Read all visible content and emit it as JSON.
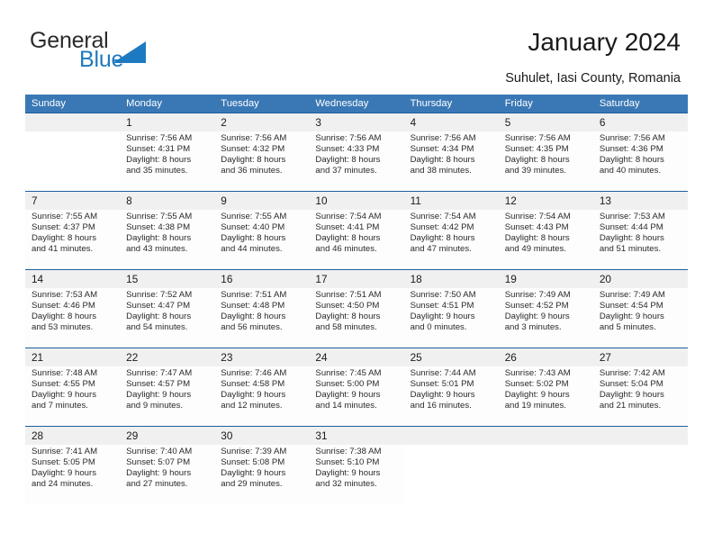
{
  "logo": {
    "word_one": "General",
    "word_two": "Blue",
    "triangle_color": "#1e7ac0"
  },
  "header": {
    "title": "January 2024",
    "subtitle": "Suhulet, Iasi County, Romania"
  },
  "colors": {
    "header_bar": "#3a78b5",
    "week_separator": "#1f5f9e",
    "daynum_band": "#f0f0f0",
    "logo_blue": "#1e7ac0"
  },
  "weekdays": [
    "Sunday",
    "Monday",
    "Tuesday",
    "Wednesday",
    "Thursday",
    "Friday",
    "Saturday"
  ],
  "weeks": [
    {
      "days": [
        {
          "num": "",
          "lines": []
        },
        {
          "num": "1",
          "lines": [
            "Sunrise: 7:56 AM",
            "Sunset: 4:31 PM",
            "Daylight: 8 hours",
            "and 35 minutes."
          ]
        },
        {
          "num": "2",
          "lines": [
            "Sunrise: 7:56 AM",
            "Sunset: 4:32 PM",
            "Daylight: 8 hours",
            "and 36 minutes."
          ]
        },
        {
          "num": "3",
          "lines": [
            "Sunrise: 7:56 AM",
            "Sunset: 4:33 PM",
            "Daylight: 8 hours",
            "and 37 minutes."
          ]
        },
        {
          "num": "4",
          "lines": [
            "Sunrise: 7:56 AM",
            "Sunset: 4:34 PM",
            "Daylight: 8 hours",
            "and 38 minutes."
          ]
        },
        {
          "num": "5",
          "lines": [
            "Sunrise: 7:56 AM",
            "Sunset: 4:35 PM",
            "Daylight: 8 hours",
            "and 39 minutes."
          ]
        },
        {
          "num": "6",
          "lines": [
            "Sunrise: 7:56 AM",
            "Sunset: 4:36 PM",
            "Daylight: 8 hours",
            "and 40 minutes."
          ]
        }
      ]
    },
    {
      "days": [
        {
          "num": "7",
          "lines": [
            "Sunrise: 7:55 AM",
            "Sunset: 4:37 PM",
            "Daylight: 8 hours",
            "and 41 minutes."
          ]
        },
        {
          "num": "8",
          "lines": [
            "Sunrise: 7:55 AM",
            "Sunset: 4:38 PM",
            "Daylight: 8 hours",
            "and 43 minutes."
          ]
        },
        {
          "num": "9",
          "lines": [
            "Sunrise: 7:55 AM",
            "Sunset: 4:40 PM",
            "Daylight: 8 hours",
            "and 44 minutes."
          ]
        },
        {
          "num": "10",
          "lines": [
            "Sunrise: 7:54 AM",
            "Sunset: 4:41 PM",
            "Daylight: 8 hours",
            "and 46 minutes."
          ]
        },
        {
          "num": "11",
          "lines": [
            "Sunrise: 7:54 AM",
            "Sunset: 4:42 PM",
            "Daylight: 8 hours",
            "and 47 minutes."
          ]
        },
        {
          "num": "12",
          "lines": [
            "Sunrise: 7:54 AM",
            "Sunset: 4:43 PM",
            "Daylight: 8 hours",
            "and 49 minutes."
          ]
        },
        {
          "num": "13",
          "lines": [
            "Sunrise: 7:53 AM",
            "Sunset: 4:44 PM",
            "Daylight: 8 hours",
            "and 51 minutes."
          ]
        }
      ]
    },
    {
      "days": [
        {
          "num": "14",
          "lines": [
            "Sunrise: 7:53 AM",
            "Sunset: 4:46 PM",
            "Daylight: 8 hours",
            "and 53 minutes."
          ]
        },
        {
          "num": "15",
          "lines": [
            "Sunrise: 7:52 AM",
            "Sunset: 4:47 PM",
            "Daylight: 8 hours",
            "and 54 minutes."
          ]
        },
        {
          "num": "16",
          "lines": [
            "Sunrise: 7:51 AM",
            "Sunset: 4:48 PM",
            "Daylight: 8 hours",
            "and 56 minutes."
          ]
        },
        {
          "num": "17",
          "lines": [
            "Sunrise: 7:51 AM",
            "Sunset: 4:50 PM",
            "Daylight: 8 hours",
            "and 58 minutes."
          ]
        },
        {
          "num": "18",
          "lines": [
            "Sunrise: 7:50 AM",
            "Sunset: 4:51 PM",
            "Daylight: 9 hours",
            "and 0 minutes."
          ]
        },
        {
          "num": "19",
          "lines": [
            "Sunrise: 7:49 AM",
            "Sunset: 4:52 PM",
            "Daylight: 9 hours",
            "and 3 minutes."
          ]
        },
        {
          "num": "20",
          "lines": [
            "Sunrise: 7:49 AM",
            "Sunset: 4:54 PM",
            "Daylight: 9 hours",
            "and 5 minutes."
          ]
        }
      ]
    },
    {
      "days": [
        {
          "num": "21",
          "lines": [
            "Sunrise: 7:48 AM",
            "Sunset: 4:55 PM",
            "Daylight: 9 hours",
            "and 7 minutes."
          ]
        },
        {
          "num": "22",
          "lines": [
            "Sunrise: 7:47 AM",
            "Sunset: 4:57 PM",
            "Daylight: 9 hours",
            "and 9 minutes."
          ]
        },
        {
          "num": "23",
          "lines": [
            "Sunrise: 7:46 AM",
            "Sunset: 4:58 PM",
            "Daylight: 9 hours",
            "and 12 minutes."
          ]
        },
        {
          "num": "24",
          "lines": [
            "Sunrise: 7:45 AM",
            "Sunset: 5:00 PM",
            "Daylight: 9 hours",
            "and 14 minutes."
          ]
        },
        {
          "num": "25",
          "lines": [
            "Sunrise: 7:44 AM",
            "Sunset: 5:01 PM",
            "Daylight: 9 hours",
            "and 16 minutes."
          ]
        },
        {
          "num": "26",
          "lines": [
            "Sunrise: 7:43 AM",
            "Sunset: 5:02 PM",
            "Daylight: 9 hours",
            "and 19 minutes."
          ]
        },
        {
          "num": "27",
          "lines": [
            "Sunrise: 7:42 AM",
            "Sunset: 5:04 PM",
            "Daylight: 9 hours",
            "and 21 minutes."
          ]
        }
      ]
    },
    {
      "days": [
        {
          "num": "28",
          "lines": [
            "Sunrise: 7:41 AM",
            "Sunset: 5:05 PM",
            "Daylight: 9 hours",
            "and 24 minutes."
          ]
        },
        {
          "num": "29",
          "lines": [
            "Sunrise: 7:40 AM",
            "Sunset: 5:07 PM",
            "Daylight: 9 hours",
            "and 27 minutes."
          ]
        },
        {
          "num": "30",
          "lines": [
            "Sunrise: 7:39 AM",
            "Sunset: 5:08 PM",
            "Daylight: 9 hours",
            "and 29 minutes."
          ]
        },
        {
          "num": "31",
          "lines": [
            "Sunrise: 7:38 AM",
            "Sunset: 5:10 PM",
            "Daylight: 9 hours",
            "and 32 minutes."
          ]
        },
        {
          "num": "",
          "lines": []
        },
        {
          "num": "",
          "lines": []
        },
        {
          "num": "",
          "lines": []
        }
      ]
    }
  ]
}
